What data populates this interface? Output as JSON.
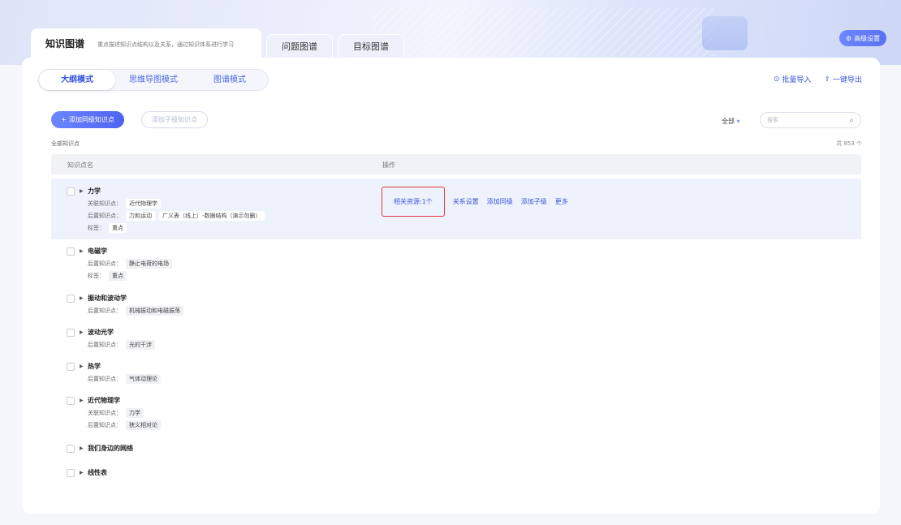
{
  "header": {
    "tabs": [
      {
        "label": "知识图谱",
        "desc": "重点描述知识点结构以及关系，通过知识体系进行学习"
      },
      {
        "label": "问题图谱"
      },
      {
        "label": "目标图谱"
      }
    ],
    "advanced_settings": "高级设置"
  },
  "modes": [
    "大纲模式",
    "思维导图模式",
    "图谱模式"
  ],
  "top_actions": {
    "import": "批量导入",
    "export": "一键导出"
  },
  "toolbar": {
    "add_sibling": "添加同级知识点",
    "add_child": "添加子级知识点",
    "filter": "全部",
    "search_placeholder": "搜索"
  },
  "list": {
    "title": "全部知识点",
    "total": "共 853 个",
    "columns": [
      "知识点名",
      "操作"
    ],
    "labels": {
      "related": "关联知识点：",
      "post": "后置知识点：",
      "tag": "标签："
    }
  },
  "rows": [
    {
      "name": "力学",
      "related": [
        "近代物理学"
      ],
      "post": [
        "力和运动",
        "广义表（线上）-数据结构（演示勿删）"
      ],
      "tags": [
        "重点"
      ],
      "ops": {
        "resource": "相关资源:1个",
        "relation": "关系设置",
        "add_sibling": "添加同级",
        "add_child": "添加子级",
        "more": "更多"
      }
    },
    {
      "name": "电磁学",
      "post": [
        "静止电荷的电场"
      ],
      "tags": [
        "重点"
      ]
    },
    {
      "name": "振动和波动学",
      "post": [
        "机械振动和电磁振荡"
      ]
    },
    {
      "name": "波动光学",
      "post": [
        "光的干涉"
      ]
    },
    {
      "name": "热学",
      "post": [
        "气体动理论"
      ]
    },
    {
      "name": "近代物理学",
      "related": [
        "力学"
      ],
      "post": [
        "狭义相对论"
      ]
    },
    {
      "name": "我们身边的网络"
    },
    {
      "name": "线性表"
    }
  ],
  "colors": {
    "accent": "#3a55dc",
    "highlight_row": "#eef2fd",
    "box": "#e03a3a"
  }
}
